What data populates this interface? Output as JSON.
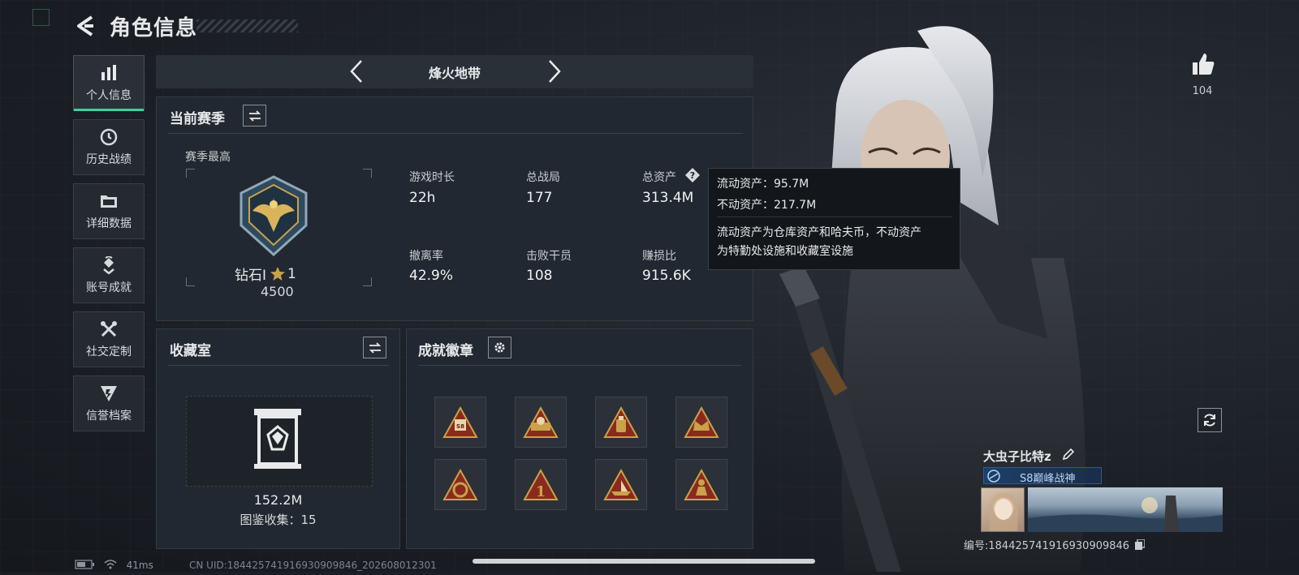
{
  "header": {
    "title": "角色信息"
  },
  "sidebar": {
    "items": [
      {
        "label": "个人信息",
        "icon": "bar-chart-icon",
        "active": true
      },
      {
        "label": "历史战绩",
        "icon": "history-clock-icon"
      },
      {
        "label": "详细数据",
        "icon": "folder-icon"
      },
      {
        "label": "账号成就",
        "icon": "achievement-icon"
      },
      {
        "label": "社交定制",
        "icon": "tools-icon"
      },
      {
        "label": "信誉档案",
        "icon": "shield-icon"
      }
    ]
  },
  "mode": {
    "name": "烽火地带"
  },
  "season": {
    "title": "当前赛季",
    "best_label": "赛季最高",
    "rank_name": "钻石Ⅰ",
    "rank_stars": "1",
    "rank_points": "4500",
    "stats": [
      {
        "label": "游戏时长",
        "value": "22h"
      },
      {
        "label": "总战局",
        "value": "177"
      },
      {
        "label": "总资产",
        "value": "313.4M"
      },
      {
        "label": "撤离率",
        "value": "42.9%"
      },
      {
        "label": "击败干员",
        "value": "108"
      },
      {
        "label": "赚损比",
        "value": "915.6K"
      }
    ]
  },
  "tooltip": {
    "line1": "流动资产：95.7M",
    "line2": "不动资产：217.7M",
    "desc1": "流动资产为仓库资产和哈夫币，不动资产",
    "desc2": "为特勤处设施和收藏室设施"
  },
  "collection": {
    "title": "收藏室",
    "value": "152.2M",
    "catalog": "图鉴收集：15"
  },
  "achievements": {
    "title": "成就徽章",
    "badges": [
      "s8-badge",
      "ammo-badge",
      "bag-badge",
      "crown-badge",
      "wreath-badge",
      "number-one-badge",
      "ship-badge",
      "soldier-badge"
    ]
  },
  "likes": {
    "count": "104"
  },
  "player": {
    "name": "大虫子比特z",
    "title_badge": "S8巅峰战神",
    "id_line": "编号:18442574191693090984​6"
  },
  "status": {
    "ping": "41ms",
    "cn_uid": "CN UID:18442574191693090984​6_202608012301"
  },
  "colors": {
    "accent": "#3ad29a",
    "gold": "#c9a24a",
    "badge_red": "#8a2a1f"
  }
}
